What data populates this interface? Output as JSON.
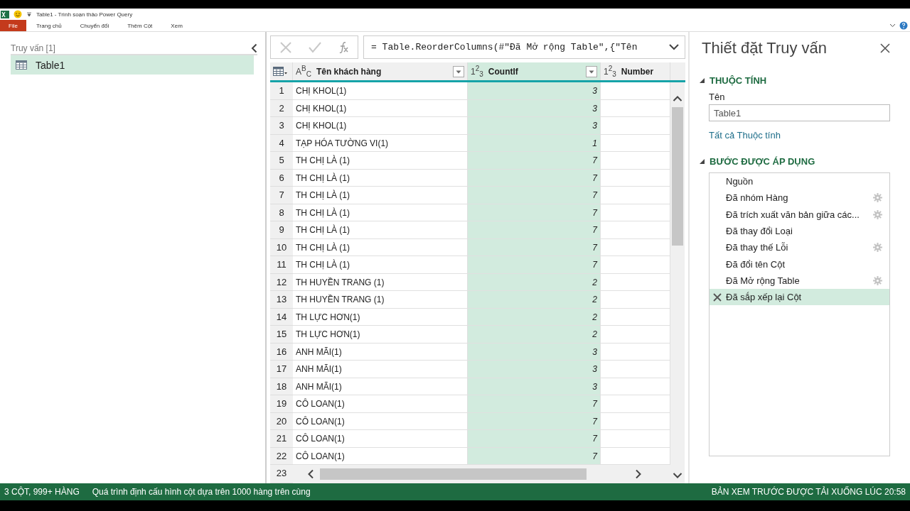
{
  "window": {
    "title": "Table1 - Trình soạn thảo Power Query"
  },
  "ribbon_tabs": [
    {
      "label": "File",
      "kind": "file",
      "selected": false
    },
    {
      "label": "Trang chủ",
      "kind": "tab",
      "selected": false
    },
    {
      "label": "Chuyển đổi",
      "kind": "tab",
      "selected": false
    },
    {
      "label": "Thêm Cột",
      "kind": "tab",
      "selected": false
    },
    {
      "label": "Xem",
      "kind": "tab",
      "selected": false
    }
  ],
  "queries": {
    "title": "Truy vấn [1]",
    "items": [
      {
        "name": "Table1",
        "selected": true
      }
    ]
  },
  "formula": {
    "text": "= Table.ReorderColumns(#\"Đã Mở rộng Table\",{\"Tên"
  },
  "table": {
    "columns": [
      {
        "name": "Tên khách hàng",
        "type_label": "A$^{B}$$_{C}$",
        "selected": false
      },
      {
        "name": "CountIf",
        "type_label": "1$^{2}$$_{3}$",
        "selected": true
      },
      {
        "name": "Number",
        "type_label": "1$^{2}$$_{3}$",
        "selected": false
      }
    ],
    "rows": [
      {
        "n": "1",
        "name": "CHỊ KHOL(1)",
        "count": "3"
      },
      {
        "n": "2",
        "name": "CHỊ KHOL(1)",
        "count": "3"
      },
      {
        "n": "3",
        "name": "CHỊ KHOL(1)",
        "count": "3"
      },
      {
        "n": "4",
        "name": "TẠP HÓA TƯỜNG VI(1)",
        "count": "1"
      },
      {
        "n": "5",
        "name": "TH CHỊ LÀ (1)",
        "count": "7"
      },
      {
        "n": "6",
        "name": "TH CHỊ LÀ (1)",
        "count": "7"
      },
      {
        "n": "7",
        "name": "TH CHỊ LÀ (1)",
        "count": "7"
      },
      {
        "n": "8",
        "name": "TH CHỊ LÀ (1)",
        "count": "7"
      },
      {
        "n": "9",
        "name": "TH CHỊ LÀ (1)",
        "count": "7"
      },
      {
        "n": "10",
        "name": "TH CHỊ LÀ (1)",
        "count": "7"
      },
      {
        "n": "11",
        "name": "TH CHỊ LÀ (1)",
        "count": "7"
      },
      {
        "n": "12",
        "name": "TH HUYỀN TRANG (1)",
        "count": "2"
      },
      {
        "n": "13",
        "name": "TH HUYỀN TRANG (1)",
        "count": "2"
      },
      {
        "n": "14",
        "name": "TH LỰC HƠN(1)",
        "count": "2"
      },
      {
        "n": "15",
        "name": "TH LỰC HƠN(1)",
        "count": "2"
      },
      {
        "n": "16",
        "name": "ANH MÃI(1)",
        "count": "3"
      },
      {
        "n": "17",
        "name": "ANH MÃI(1)",
        "count": "3"
      },
      {
        "n": "18",
        "name": "ANH MÃI(1)",
        "count": "3"
      },
      {
        "n": "19",
        "name": "CÔ LOAN(1)",
        "count": "7"
      },
      {
        "n": "20",
        "name": "CÔ LOAN(1)",
        "count": "7"
      },
      {
        "n": "21",
        "name": "CÔ LOAN(1)",
        "count": "7"
      },
      {
        "n": "22",
        "name": "CÔ LOAN(1)",
        "count": "7"
      }
    ],
    "last_row_number": "23"
  },
  "settings": {
    "title": "Thiết đặt Truy vấn",
    "properties_heading": "THUỘC TÍNH",
    "name_label": "Tên",
    "name_value": "Table1",
    "all_properties_link": "Tất cả Thuộc tính",
    "steps_heading": "BƯỚC ĐƯỢC ÁP DỤNG",
    "steps": [
      {
        "name": "Nguồn",
        "has_settings": false,
        "selected": false
      },
      {
        "name": "Đã nhóm Hàng",
        "has_settings": true,
        "selected": false
      },
      {
        "name": "Đã trích xuất văn bản giữa các...",
        "has_settings": true,
        "selected": false
      },
      {
        "name": "Đã thay đổi Loại",
        "has_settings": false,
        "selected": false
      },
      {
        "name": "Đã thay thế Lỗi",
        "has_settings": true,
        "selected": false
      },
      {
        "name": "Đã đổi tên Cột",
        "has_settings": false,
        "selected": false
      },
      {
        "name": "Đã Mở rộng Table",
        "has_settings": true,
        "selected": false
      },
      {
        "name": "Đã sắp xếp lại Cột",
        "has_settings": false,
        "selected": true
      }
    ]
  },
  "status_bar": {
    "left": "3 CỘT, 999+ HÀNG",
    "message": "Quá trình định cấu hình cột dựa trên 1000 hàng trên cùng",
    "right": "BẢN XEM TRƯỚC ĐƯỢC TẢI XUỐNG LÚC 20:58"
  }
}
